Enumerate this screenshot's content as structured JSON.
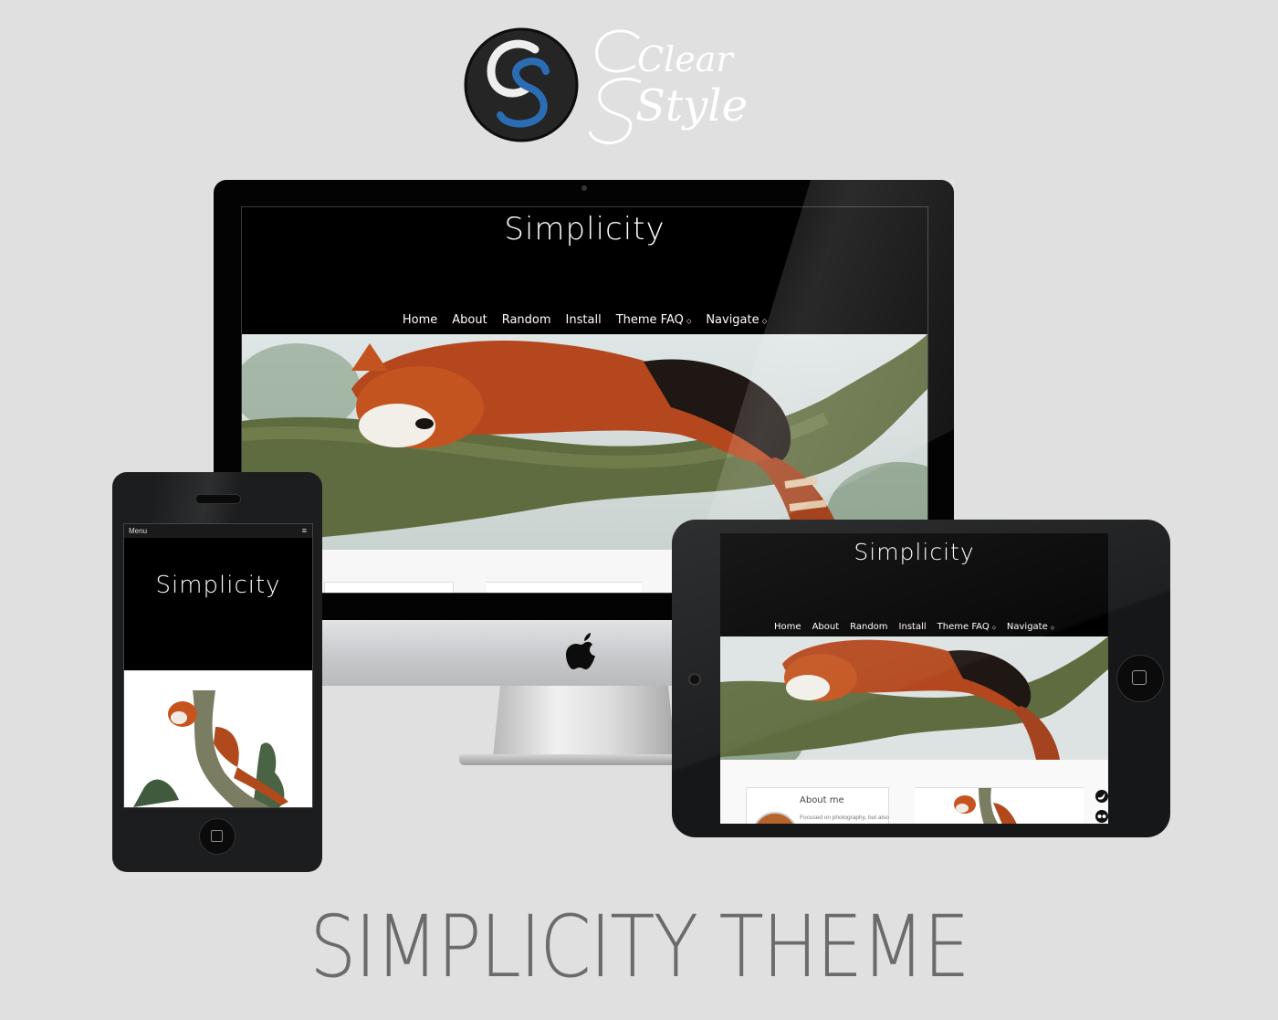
{
  "brand": {
    "logo_letters": "CS",
    "logo_word_1": "Clear",
    "logo_word_2": "Style"
  },
  "theme_title": "SIMPLICITY THEME",
  "desktop": {
    "site_title": "Simplicity",
    "nav": [
      {
        "label": "Home"
      },
      {
        "label": "About"
      },
      {
        "label": "Random"
      },
      {
        "label": "Install"
      },
      {
        "label": "Theme FAQ",
        "has_dropdown": true
      },
      {
        "label": "Navigate",
        "has_dropdown": true
      }
    ],
    "dropdown_glyph": "⬦"
  },
  "phone": {
    "menu_label": "Menu",
    "menu_icon": "≡",
    "site_title": "Simplicity"
  },
  "tablet": {
    "site_title": "Simplicity",
    "nav": [
      {
        "label": "Home"
      },
      {
        "label": "About"
      },
      {
        "label": "Random"
      },
      {
        "label": "Install"
      },
      {
        "label": "Theme FAQ",
        "has_dropdown": true
      },
      {
        "label": "Navigate",
        "has_dropdown": true
      }
    ],
    "dropdown_glyph": "⬦",
    "about_title": "About me",
    "about_text": "Focused on photography, but also"
  },
  "colors": {
    "background": "#e0e0e0",
    "logo_blue": "#2a6db5",
    "title_gray": "#6b6b6b"
  }
}
